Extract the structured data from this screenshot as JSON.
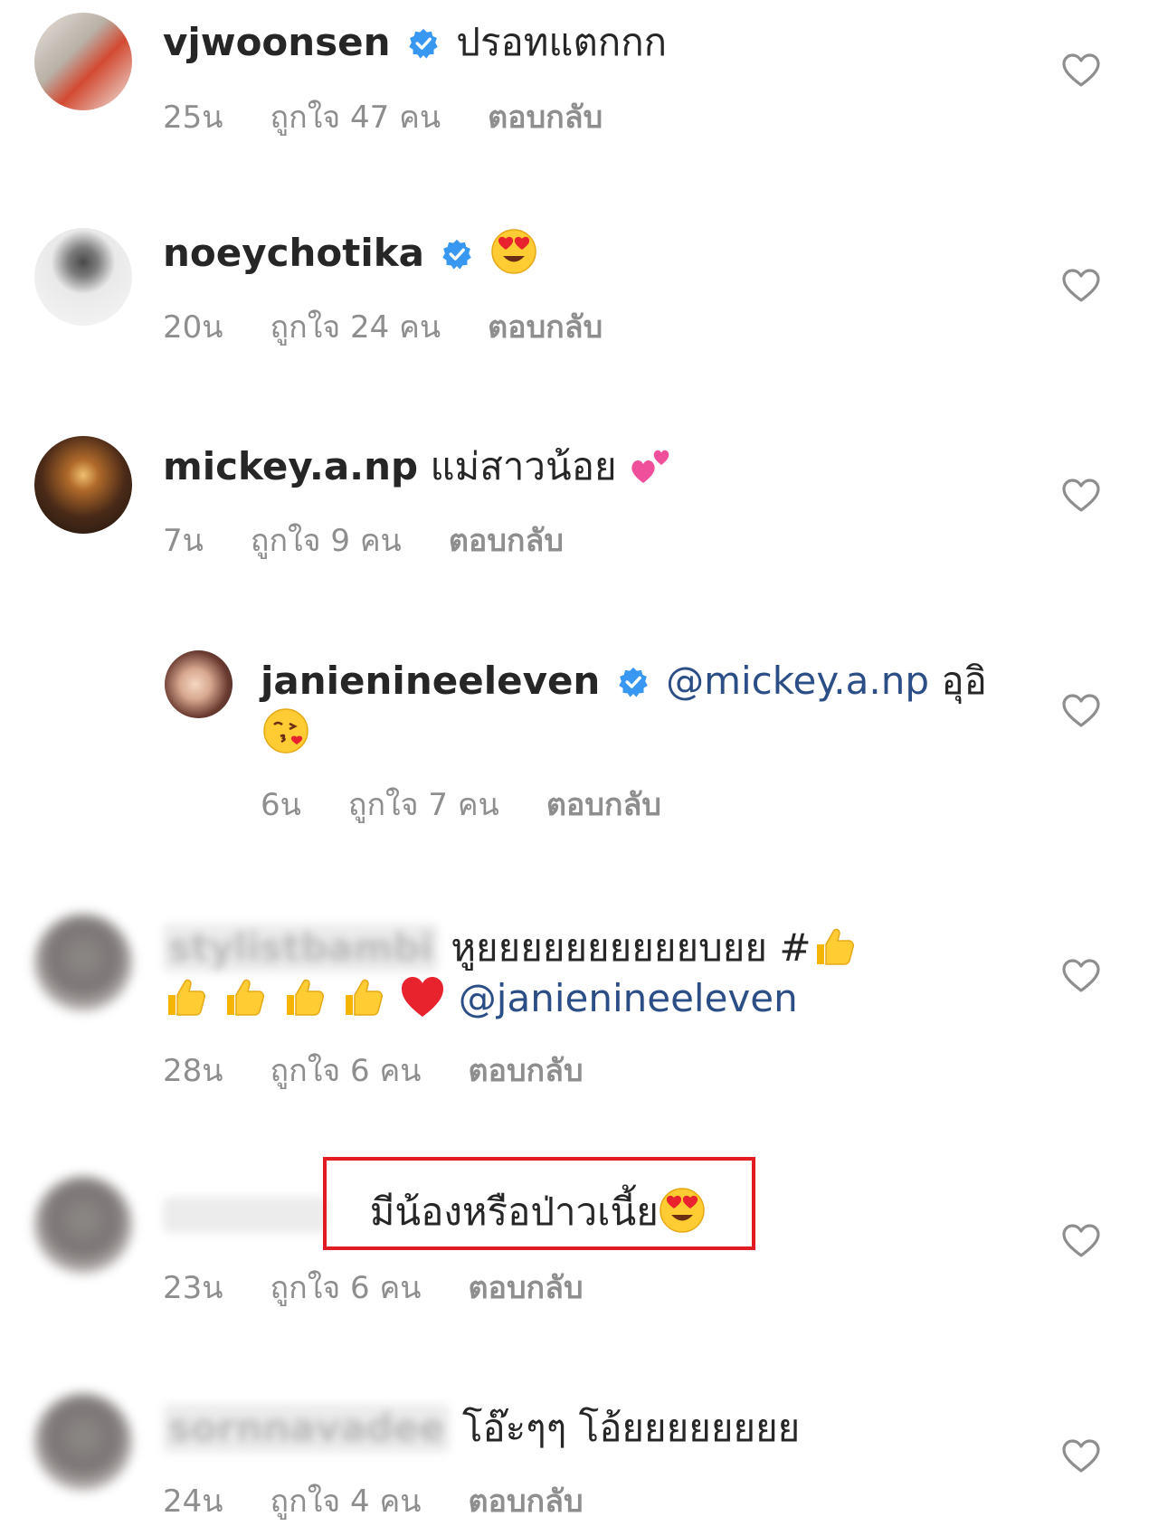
{
  "comments": [
    {
      "username": "vjwoonsen",
      "text": "ปรอทแตกกก",
      "time": "25น",
      "likes": "ถูกใจ 47 คน",
      "reply": "ตอบกลับ"
    },
    {
      "username": "noeychotika",
      "time": "20น",
      "likes": "ถูกใจ 24 คน",
      "reply": "ตอบกลับ"
    },
    {
      "username": "mickey.a.np",
      "text": "แม่สาวน้อย",
      "time": "7น",
      "likes": "ถูกใจ 9 คน",
      "reply": "ตอบกลับ"
    },
    {
      "username": "janienineeleven",
      "mention": "@mickey.a.np",
      "text": "อุอิ",
      "time": "6น",
      "likes": "ถูกใจ 7 คน",
      "reply": "ตอบกลับ"
    },
    {
      "username": "stylistbambi",
      "text": "หูยยยยยยยยยยบยย #",
      "mention": "@janienineeleven",
      "time": "28น",
      "likes": "ถูกใจ 6 คน",
      "reply": "ตอบกลับ"
    },
    {
      "username": "",
      "text": "มีน้องหรือป่าวเนี้ย",
      "time": "23น",
      "likes": "ถูกใจ 6 คน",
      "reply": "ตอบกลับ"
    },
    {
      "username": "sornnavadee",
      "text": "โอ๊ะๆๆ โอ้ยยยยยยยย",
      "time": "24น",
      "likes": "ถูกใจ 4 คน",
      "reply": "ตอบกลับ"
    }
  ],
  "colors": {
    "text": "#262626",
    "meta": "#8e8e8e",
    "mention": "#2c4e86",
    "verified": "#3897f0",
    "highlight": "#e11b22"
  },
  "icons": [
    "verified-badge-icon",
    "heart-outline-icon",
    "heart-eyes-emoji",
    "two-hearts-emoji",
    "kissing-heart-emoji",
    "thumbs-up-emoji",
    "red-heart-emoji"
  ]
}
